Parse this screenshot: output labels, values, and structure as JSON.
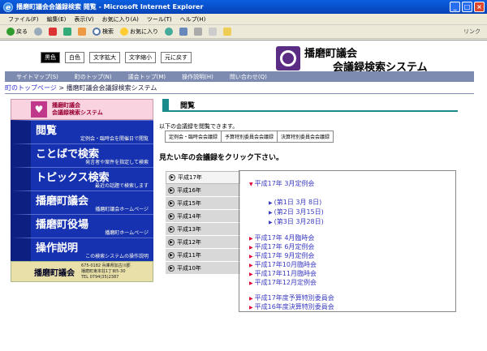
{
  "window": {
    "title": "播磨町議会会議録検索 閲覧 - Microsoft Internet Explorer"
  },
  "menu": [
    "ファイル(F)",
    "編集(E)",
    "表示(V)",
    "お気に入り(A)",
    "ツール(T)",
    "ヘルプ(H)"
  ],
  "toolbar": {
    "back": "戻る",
    "search": "検索",
    "favorites": "お気に入り",
    "links": "リンク"
  },
  "display_buttons": {
    "black": "黒色",
    "white": "白色",
    "enlarge": "文字拡大",
    "shrink": "文字縮小",
    "reset": "元に戻す"
  },
  "site": {
    "title_line1": "播磨町議会",
    "title_line2": "会議録検索システム"
  },
  "nav": [
    "サイトマップ(S)",
    "町のトップ(N)",
    "議会トップ(M)",
    "操作説明(H)",
    "問い合わせ(Q)"
  ],
  "breadcrumb": {
    "home": "町のトップページ",
    "sep": " > ",
    "current": "播磨町議会会議録検索システム"
  },
  "sidebar": {
    "top_line1": "播磨町議会",
    "top_line2": "会議録検索システム",
    "items": [
      {
        "big": "閲覧",
        "small": "定例会・臨時会を開催日で閲覧"
      },
      {
        "big": "ことばで検索",
        "small": "発言者や案件を指定して検索"
      },
      {
        "big": "トピックス検索",
        "small": "最近の話題で検索します"
      },
      {
        "big": "播磨町議会",
        "small": "播磨町議会ホームページ"
      },
      {
        "big": "播磨町役場",
        "small": "播磨町ホームページ"
      },
      {
        "big": "操作説明",
        "small": "この検索システムの操作説明"
      }
    ],
    "bottom_title": "播磨町議会",
    "addr1": "675-0182 兵庫県加古川郡",
    "addr2": "播磨町東本荘1丁目5-30",
    "addr3": "TEL 0794(35)2387"
  },
  "main": {
    "heading": "閲覧",
    "intro": "以下の会議録を閲覧できます。",
    "categories": [
      "定例会・臨時会会議録",
      "予算特別委員会会議録",
      "決算特別委員会会議録"
    ],
    "instruction": "見たい年の会議録をクリック下さい。",
    "years": [
      "平成17年",
      "平成16年",
      "平成15年",
      "平成14年",
      "平成13年",
      "平成12年",
      "平成11年",
      "平成10年"
    ],
    "open_meeting": "平成17年 3月定例会",
    "sub_days": [
      "(第1日 3月 8日)",
      "(第2日 3月15日)",
      "(第3日 3月28日)"
    ],
    "meetings": [
      "平成17年 4月臨時会",
      "平成17年 6月定例会",
      "平成17年 9月定例会",
      "平成17年10月臨時会",
      "平成17年11月臨時会",
      "平成17年12月定例会"
    ],
    "committees": [
      "平成17年度予算特別委員会",
      "平成16年度決算特別委員会"
    ]
  }
}
